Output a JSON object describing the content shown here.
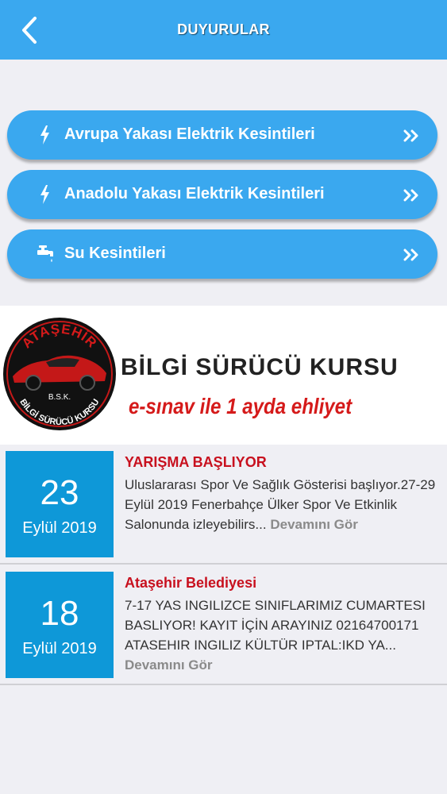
{
  "header": {
    "title": "DUYURULAR",
    "back_icon": "chevron-left-icon"
  },
  "menu": {
    "items": [
      {
        "label": "Avrupa Yakası Elektrik Kesintileri",
        "icon": "lightning-icon"
      },
      {
        "label": "Anadolu Yakası Elektrik Kesintileri",
        "icon": "lightning-icon"
      },
      {
        "label": "Su Kesintileri",
        "icon": "water-tap-icon"
      }
    ],
    "chevron_icon": "double-chevron-right-icon"
  },
  "banner": {
    "logo_text_top": "ATAŞEHİR",
    "logo_text_mid": "B.S.K.",
    "logo_text_bottom": "BİLGİ SÜRÜCÜ KURSU",
    "brand": "BİLGİ SÜRÜCÜ KURSU",
    "slogan": "e-sınav ile 1 ayda ehliyet"
  },
  "news": [
    {
      "day": "23",
      "month_year": "Eylül 2019",
      "title": "YARIŞMA BAŞLIYOR",
      "body": "Uluslararası Spor Ve Sağlık Gösterisi başlıyor.27-29 Eylül 2019 Fenerbahçe Ülker Spor Ve Etkinlik Salonunda izleyebilirs...",
      "more": "Devamını Gör"
    },
    {
      "day": "18",
      "month_year": "Eylül 2019",
      "title": "Ataşehir Belediyesi",
      "body": "7-17 YAS INGILIZCE SINIFLARIMIZ CUMARTESI BASLIYOR! KAYIT İÇİN ARAYINIZ 02164700171 ATASEHIR INGILIZ KÜLTÜR IPTAL:IKD YA...",
      "more": "Devamını Gör"
    }
  ],
  "colors": {
    "accent": "#3aa8ef",
    "date_box": "#0e98d8",
    "news_title": "#c8101e",
    "slogan": "#d51a1a",
    "background": "#efeff4"
  }
}
